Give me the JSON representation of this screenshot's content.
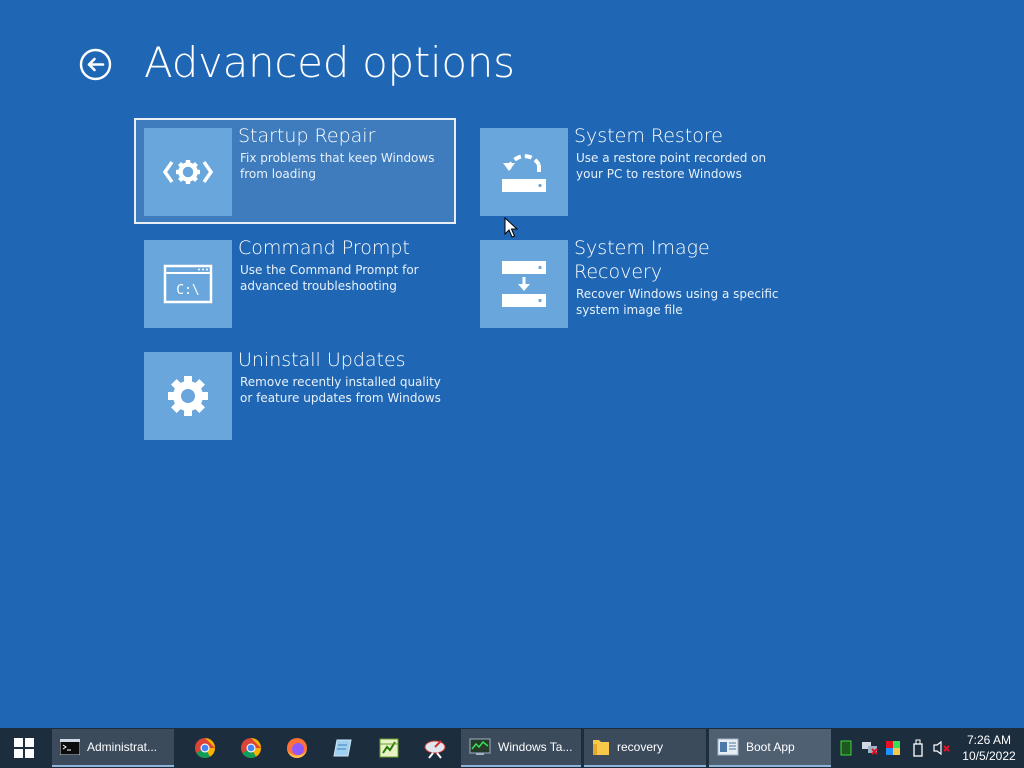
{
  "page": {
    "title": "Advanced options"
  },
  "options": [
    {
      "title": "Startup Repair",
      "description": "Fix problems that keep Windows from loading",
      "icon": "startup-repair-icon",
      "selected": true
    },
    {
      "title": "System Restore",
      "description": "Use a restore point recorded on your PC to restore Windows",
      "icon": "system-restore-icon"
    },
    {
      "title": "Command Prompt",
      "description": "Use the Command Prompt for advanced troubleshooting",
      "icon": "command-prompt-icon"
    },
    {
      "title": "System Image Recovery",
      "description": "Recover Windows using a specific system image file",
      "icon": "system-image-recovery-icon"
    },
    {
      "title": "Uninstall Updates",
      "description": "Remove recently installed quality or feature updates from Windows",
      "icon": "gear-icon"
    }
  ],
  "command_prompt_glyph": "C:\\",
  "taskbar": {
    "items": [
      {
        "label": "Administrat...",
        "icon": "cmd-icon"
      },
      {
        "label": "Windows Ta...",
        "icon": "task-manager-icon"
      },
      {
        "label": "recovery",
        "icon": "folder-icon"
      },
      {
        "label": "Boot App",
        "icon": "boot-app-icon"
      }
    ],
    "pinned": [
      "chrome-icon",
      "chrome-icon",
      "firefox-icon",
      "notepad-icon",
      "spreadsheet-icon",
      "satellite-icon"
    ],
    "clock": {
      "time": "7:26 AM",
      "date": "10/5/2022"
    }
  },
  "colors": {
    "background": "#1f67b4",
    "tile": "#68a6dc",
    "taskbar": "#1c2d3e"
  }
}
